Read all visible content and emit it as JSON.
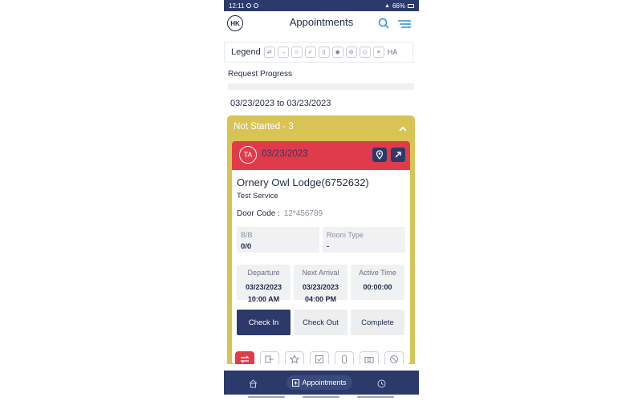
{
  "status_bar": {
    "time": "12:11",
    "battery": "66%"
  },
  "header": {
    "avatar_initials": "HK",
    "title": "Appointments"
  },
  "legend": {
    "label": "Legend",
    "icons": [
      "swap-icon",
      "exit-icon",
      "star-icon",
      "checkbox-icon",
      "clip-icon",
      "camera-icon",
      "ban-icon",
      "list-icon"
    ],
    "ha_label": "HA"
  },
  "progress": {
    "label": "Request Progress",
    "value": 0
  },
  "date_range": "03/23/2023 to 03/23/2023",
  "group": {
    "title": "Not Started - 3",
    "color": "#d8c455",
    "card": {
      "initials": "TA",
      "date": "03/23/2023",
      "header_color": "#e03b4a",
      "property": "Ornery Owl Lodge(6752632)",
      "service": "Test Service",
      "door_label": "Door Code :",
      "door_value": "12*456789",
      "bb_label": "B/B",
      "bb_value": "0/0",
      "room_label": "Room Type",
      "room_value": "-",
      "departure_label": "Departure",
      "departure_date": "03/23/2023",
      "departure_time": "10:00 AM",
      "arrival_label": "Next Arrival",
      "arrival_date": "03/23/2023",
      "arrival_time": "04:00 PM",
      "active_label": "Active Time",
      "active_value": "00:00:00",
      "buttons": {
        "check_in": "Check In",
        "check_out": "Check Out",
        "complete": "Complete"
      }
    }
  },
  "bottom_nav": {
    "appointments_label": "Appointments"
  }
}
